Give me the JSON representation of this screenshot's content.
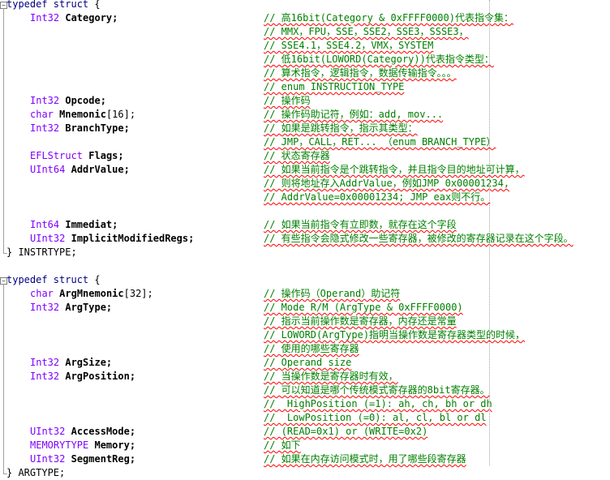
{
  "colors": {
    "keyword": "#000080",
    "type": "#8000ff",
    "comment": "#008000",
    "identifier": "#000000",
    "squiggle": "#ff0000"
  },
  "blocks": [
    {
      "header": {
        "kw": "typedef struct",
        "brace": " {"
      },
      "fields": [
        {
          "type": "Int32",
          "name": "Category;",
          "comments": [
            "// 高16bit(Category & 0xFFFF0000)代表指令集：",
            "// MMX，FPU，SSE，SSE2，SSE3，SSSE3，",
            "// SSE4.1，SSE4.2，VMX，SYSTEM",
            "// 低16bit(LOWORD(Category))代表指令类型：",
            "// 算术指令，逻辑指令，数据传输指令。。。",
            "// enum INSTRUCTION_TYPE"
          ]
        },
        {
          "type": "Int32",
          "name": "Opcode;",
          "comments": [
            "// 操作码"
          ]
        },
        {
          "type": "char",
          "name": "Mnemonic",
          "suffix": "[16];",
          "comments": [
            "// 操作码助记符，例如：add, mov..."
          ]
        },
        {
          "type": "Int32",
          "name": "BranchType;",
          "comments": [
            "// 如果是跳转指令，指示其类型：",
            "// JMP，CALL，RET... （enum BRANCH_TYPE）"
          ]
        },
        {
          "type": "EFLStruct",
          "name": "Flags;",
          "comments": [
            "// 状态寄存器"
          ]
        },
        {
          "type": "UInt64",
          "name": "AddrValue;",
          "comments": [
            "// 如果当前指令是个跳转指令，并且指令目的地址可计算，",
            "// 则将地址存入AddrValue，例如JMP 0x00001234,",
            "// AddrValue=0x00001234; JMP eax则不行。"
          ]
        },
        {
          "type": "Int64",
          "name": "Immediat;",
          "blank_before": true,
          "comments": [
            "// 如果当前指令有立即数，就存在这个字段"
          ]
        },
        {
          "type": "UInt32",
          "name": "ImplicitModifiedRegs;",
          "comments": [
            "// 有些指令会隐式修改一些寄存器，被修改的寄存器记录在这个字段。"
          ]
        }
      ],
      "footer": "} INSTRTYPE;"
    },
    {
      "header": {
        "kw": "typedef struct",
        "brace": " {"
      },
      "fields": [
        {
          "type": "char",
          "name": "ArgMnemonic",
          "suffix": "[32];",
          "comments": [
            "// 操作码（Operand）助记符"
          ]
        },
        {
          "type": "Int32",
          "name": "ArgType;",
          "comments": [
            "// Mode R/M (ArgType & 0xFFFF0000)",
            "// 指示当前操作数是寄存器，内存还是常量",
            "// LOWORD(ArgType)指明当操作数是寄存器类型的时候，",
            "// 使用的哪些寄存器"
          ]
        },
        {
          "type": "Int32",
          "name": "ArgSize;",
          "comments": [
            "// Operand size"
          ]
        },
        {
          "type": "Int32",
          "name": "ArgPosition;",
          "comments": [
            "// 当操作数是寄存器时有效，",
            "// 可以知道是哪个传统模式寄存器的8bit寄存器。",
            "//  HighPosition (=1): ah, ch, bh or dh",
            "//  LowPosition (=0): al, cl, bl or dl"
          ]
        },
        {
          "type": "UInt32",
          "name": "AccessMode;",
          "comments": [
            "// (READ=0x1) or (WRITE=0x2)"
          ]
        },
        {
          "type": "MEMORYTYPE",
          "name": "Memory;",
          "comments": [
            "// 如下"
          ]
        },
        {
          "type": "UInt32",
          "name": "SegmentReg;",
          "comments": [
            "// 如果在内存访问模式时，用了哪些段寄存器"
          ]
        }
      ],
      "footer": "} ARGTYPE;"
    }
  ]
}
